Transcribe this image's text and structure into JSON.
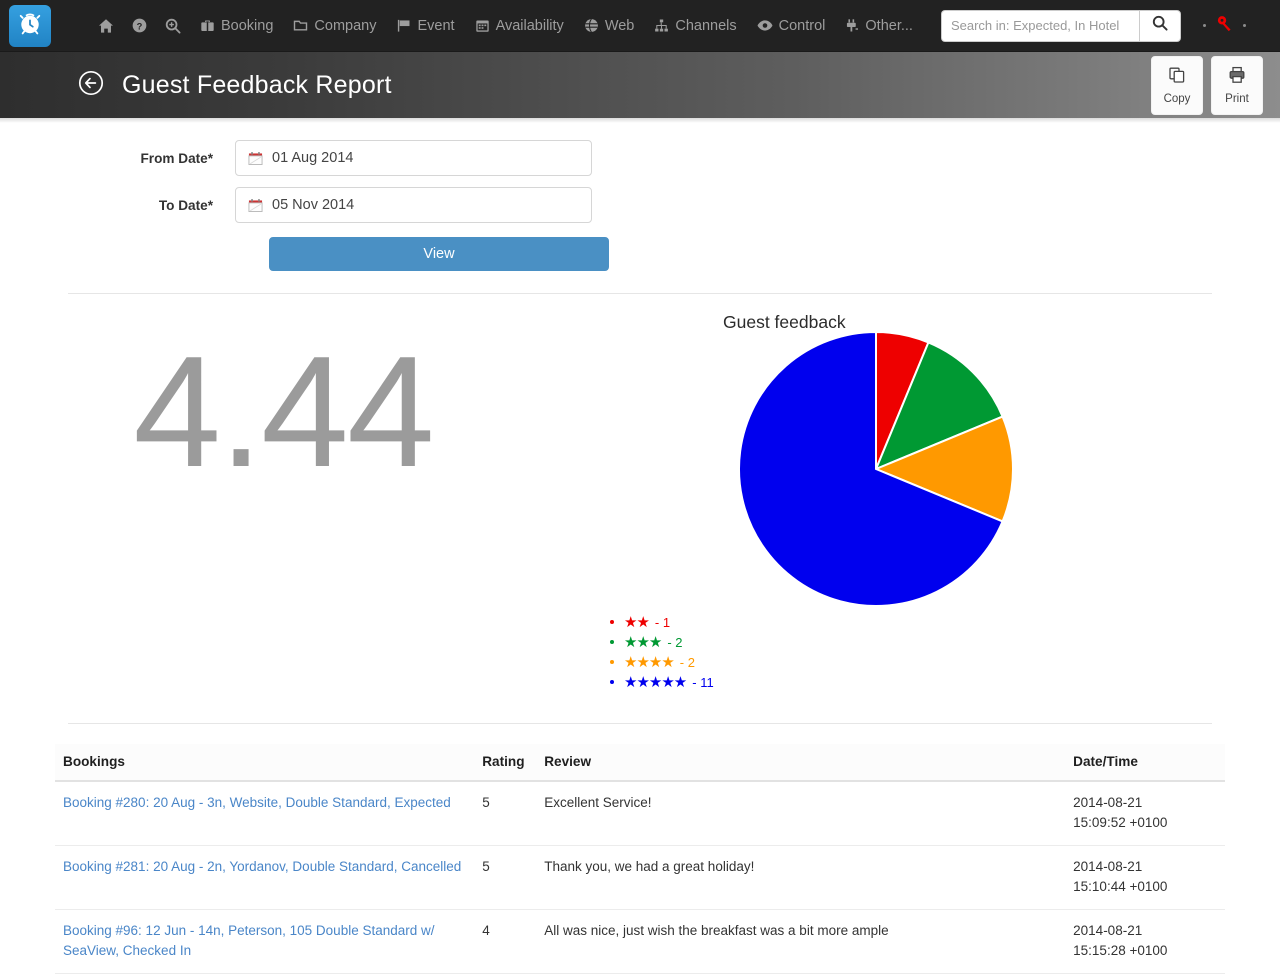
{
  "navbar": {
    "brand_icon": "alarm-clock-icon",
    "items": [
      {
        "label": "",
        "icon": "home-icon",
        "icon_only": true
      },
      {
        "label": "",
        "icon": "help-circle-icon",
        "icon_only": true
      },
      {
        "label": "",
        "icon": "zoom-in-icon",
        "icon_only": true
      },
      {
        "label": "Booking",
        "icon": "briefcase-icon",
        "icon_only": false
      },
      {
        "label": "Company",
        "icon": "folder-icon",
        "icon_only": false
      },
      {
        "label": "Event",
        "icon": "flag-icon",
        "icon_only": false
      },
      {
        "label": "Availability",
        "icon": "calendar-icon",
        "icon_only": false
      },
      {
        "label": "Web",
        "icon": "globe-icon",
        "icon_only": false
      },
      {
        "label": "Channels",
        "icon": "sitemap-icon",
        "icon_only": false
      },
      {
        "label": "Control",
        "icon": "eye-icon",
        "icon_only": false
      },
      {
        "label": "Other...",
        "icon": "plug-icon",
        "icon_only": false
      }
    ],
    "search": {
      "placeholder": "Search in: Expected, In Hotel",
      "value": "",
      "button_icon": "search-icon"
    },
    "key_icon": "key-icon",
    "key_color": "#ee0000"
  },
  "header": {
    "back_icon": "arrow-left-circle-icon",
    "title": "Guest Feedback Report",
    "actions": [
      {
        "label": "Copy",
        "icon": "copy-icon"
      },
      {
        "label": "Print",
        "icon": "printer-icon"
      }
    ]
  },
  "form": {
    "from_date": {
      "label": "From Date*",
      "value": "01 Aug 2014",
      "icon": "calendar-icon"
    },
    "to_date": {
      "label": "To Date*",
      "value": "05 Nov 2014",
      "icon": "calendar-icon"
    },
    "view_button": "View"
  },
  "summary": {
    "average_rating": "4.44"
  },
  "chart_data": {
    "type": "pie",
    "title": "Guest feedback",
    "categories": [
      "2 stars",
      "3 stars",
      "4 stars",
      "5 stars"
    ],
    "values": [
      1,
      2,
      2,
      11
    ],
    "total": 16,
    "colors": [
      "#ee0000",
      "#009933",
      "#ff9900",
      "#0000ee"
    ],
    "start_angle_deg": 0,
    "direction": "clockwise",
    "legend_position": "below",
    "legend": [
      {
        "stars": 2,
        "star_glyphs": "★★",
        "count": "1",
        "color": "#ee0000",
        "label_suffix": "- 1"
      },
      {
        "stars": 3,
        "star_glyphs": "★★★",
        "count": "2",
        "color": "#009933",
        "label_suffix": "- 2"
      },
      {
        "stars": 4,
        "star_glyphs": "★★★★",
        "count": "2",
        "color": "#ff9900",
        "label_suffix": "- 2"
      },
      {
        "stars": 5,
        "star_glyphs": "★★★★★",
        "count": "11",
        "color": "#0000ee",
        "label_suffix": "- 11"
      }
    ]
  },
  "table": {
    "columns": [
      "Bookings",
      "Rating",
      "Review",
      "Date/Time"
    ],
    "rows": [
      {
        "booking": "Booking #280: 20 Aug - 3n, Website, Double Standard, Expected",
        "rating": "5",
        "review": "Excellent Service!",
        "date": "2014-08-21",
        "time": "15:09:52 +0100"
      },
      {
        "booking": "Booking #281: 20 Aug - 2n, Yordanov, Double Standard, Cancelled",
        "rating": "5",
        "review": "Thank you, we had a great holiday!",
        "date": "2014-08-21",
        "time": "15:10:44 +0100"
      },
      {
        "booking": "Booking #96: 12 Jun - 14n, Peterson, 105 Double Standard w/ SeaView, Checked In",
        "rating": "4",
        "review": "All was nice, just wish the breakfast was a bit more ample",
        "date": "2014-08-21",
        "time": "15:15:28 +0100"
      }
    ]
  }
}
